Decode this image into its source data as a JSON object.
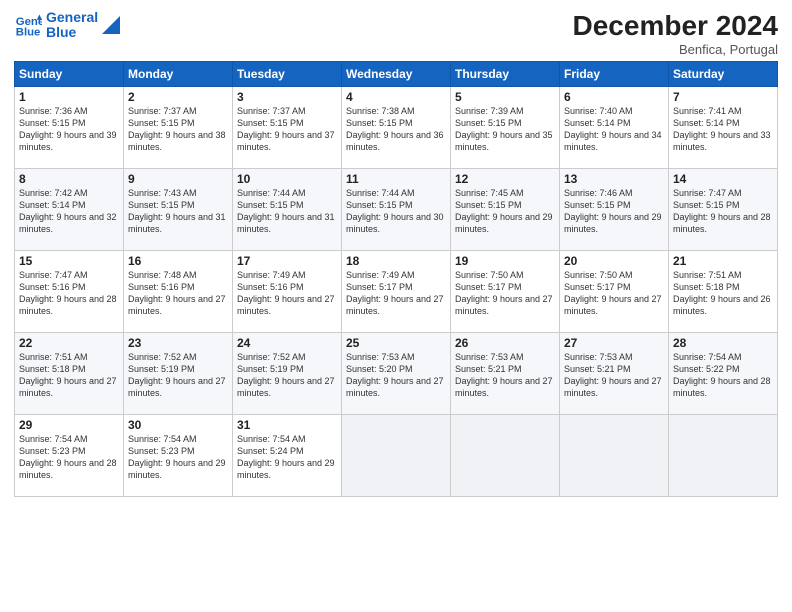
{
  "header": {
    "logo_line1": "General",
    "logo_line2": "Blue",
    "month_year": "December 2024",
    "location": "Benfica, Portugal"
  },
  "weekdays": [
    "Sunday",
    "Monday",
    "Tuesday",
    "Wednesday",
    "Thursday",
    "Friday",
    "Saturday"
  ],
  "weeks": [
    [
      {
        "day": "1",
        "sunrise": "Sunrise: 7:36 AM",
        "sunset": "Sunset: 5:15 PM",
        "daylight": "Daylight: 9 hours and 39 minutes."
      },
      {
        "day": "2",
        "sunrise": "Sunrise: 7:37 AM",
        "sunset": "Sunset: 5:15 PM",
        "daylight": "Daylight: 9 hours and 38 minutes."
      },
      {
        "day": "3",
        "sunrise": "Sunrise: 7:37 AM",
        "sunset": "Sunset: 5:15 PM",
        "daylight": "Daylight: 9 hours and 37 minutes."
      },
      {
        "day": "4",
        "sunrise": "Sunrise: 7:38 AM",
        "sunset": "Sunset: 5:15 PM",
        "daylight": "Daylight: 9 hours and 36 minutes."
      },
      {
        "day": "5",
        "sunrise": "Sunrise: 7:39 AM",
        "sunset": "Sunset: 5:15 PM",
        "daylight": "Daylight: 9 hours and 35 minutes."
      },
      {
        "day": "6",
        "sunrise": "Sunrise: 7:40 AM",
        "sunset": "Sunset: 5:14 PM",
        "daylight": "Daylight: 9 hours and 34 minutes."
      },
      {
        "day": "7",
        "sunrise": "Sunrise: 7:41 AM",
        "sunset": "Sunset: 5:14 PM",
        "daylight": "Daylight: 9 hours and 33 minutes."
      }
    ],
    [
      {
        "day": "8",
        "sunrise": "Sunrise: 7:42 AM",
        "sunset": "Sunset: 5:14 PM",
        "daylight": "Daylight: 9 hours and 32 minutes."
      },
      {
        "day": "9",
        "sunrise": "Sunrise: 7:43 AM",
        "sunset": "Sunset: 5:15 PM",
        "daylight": "Daylight: 9 hours and 31 minutes."
      },
      {
        "day": "10",
        "sunrise": "Sunrise: 7:44 AM",
        "sunset": "Sunset: 5:15 PM",
        "daylight": "Daylight: 9 hours and 31 minutes."
      },
      {
        "day": "11",
        "sunrise": "Sunrise: 7:44 AM",
        "sunset": "Sunset: 5:15 PM",
        "daylight": "Daylight: 9 hours and 30 minutes."
      },
      {
        "day": "12",
        "sunrise": "Sunrise: 7:45 AM",
        "sunset": "Sunset: 5:15 PM",
        "daylight": "Daylight: 9 hours and 29 minutes."
      },
      {
        "day": "13",
        "sunrise": "Sunrise: 7:46 AM",
        "sunset": "Sunset: 5:15 PM",
        "daylight": "Daylight: 9 hours and 29 minutes."
      },
      {
        "day": "14",
        "sunrise": "Sunrise: 7:47 AM",
        "sunset": "Sunset: 5:15 PM",
        "daylight": "Daylight: 9 hours and 28 minutes."
      }
    ],
    [
      {
        "day": "15",
        "sunrise": "Sunrise: 7:47 AM",
        "sunset": "Sunset: 5:16 PM",
        "daylight": "Daylight: 9 hours and 28 minutes."
      },
      {
        "day": "16",
        "sunrise": "Sunrise: 7:48 AM",
        "sunset": "Sunset: 5:16 PM",
        "daylight": "Daylight: 9 hours and 27 minutes."
      },
      {
        "day": "17",
        "sunrise": "Sunrise: 7:49 AM",
        "sunset": "Sunset: 5:16 PM",
        "daylight": "Daylight: 9 hours and 27 minutes."
      },
      {
        "day": "18",
        "sunrise": "Sunrise: 7:49 AM",
        "sunset": "Sunset: 5:17 PM",
        "daylight": "Daylight: 9 hours and 27 minutes."
      },
      {
        "day": "19",
        "sunrise": "Sunrise: 7:50 AM",
        "sunset": "Sunset: 5:17 PM",
        "daylight": "Daylight: 9 hours and 27 minutes."
      },
      {
        "day": "20",
        "sunrise": "Sunrise: 7:50 AM",
        "sunset": "Sunset: 5:17 PM",
        "daylight": "Daylight: 9 hours and 27 minutes."
      },
      {
        "day": "21",
        "sunrise": "Sunrise: 7:51 AM",
        "sunset": "Sunset: 5:18 PM",
        "daylight": "Daylight: 9 hours and 26 minutes."
      }
    ],
    [
      {
        "day": "22",
        "sunrise": "Sunrise: 7:51 AM",
        "sunset": "Sunset: 5:18 PM",
        "daylight": "Daylight: 9 hours and 27 minutes."
      },
      {
        "day": "23",
        "sunrise": "Sunrise: 7:52 AM",
        "sunset": "Sunset: 5:19 PM",
        "daylight": "Daylight: 9 hours and 27 minutes."
      },
      {
        "day": "24",
        "sunrise": "Sunrise: 7:52 AM",
        "sunset": "Sunset: 5:19 PM",
        "daylight": "Daylight: 9 hours and 27 minutes."
      },
      {
        "day": "25",
        "sunrise": "Sunrise: 7:53 AM",
        "sunset": "Sunset: 5:20 PM",
        "daylight": "Daylight: 9 hours and 27 minutes."
      },
      {
        "day": "26",
        "sunrise": "Sunrise: 7:53 AM",
        "sunset": "Sunset: 5:21 PM",
        "daylight": "Daylight: 9 hours and 27 minutes."
      },
      {
        "day": "27",
        "sunrise": "Sunrise: 7:53 AM",
        "sunset": "Sunset: 5:21 PM",
        "daylight": "Daylight: 9 hours and 27 minutes."
      },
      {
        "day": "28",
        "sunrise": "Sunrise: 7:54 AM",
        "sunset": "Sunset: 5:22 PM",
        "daylight": "Daylight: 9 hours and 28 minutes."
      }
    ],
    [
      {
        "day": "29",
        "sunrise": "Sunrise: 7:54 AM",
        "sunset": "Sunset: 5:23 PM",
        "daylight": "Daylight: 9 hours and 28 minutes."
      },
      {
        "day": "30",
        "sunrise": "Sunrise: 7:54 AM",
        "sunset": "Sunset: 5:23 PM",
        "daylight": "Daylight: 9 hours and 29 minutes."
      },
      {
        "day": "31",
        "sunrise": "Sunrise: 7:54 AM",
        "sunset": "Sunset: 5:24 PM",
        "daylight": "Daylight: 9 hours and 29 minutes."
      },
      null,
      null,
      null,
      null
    ]
  ]
}
